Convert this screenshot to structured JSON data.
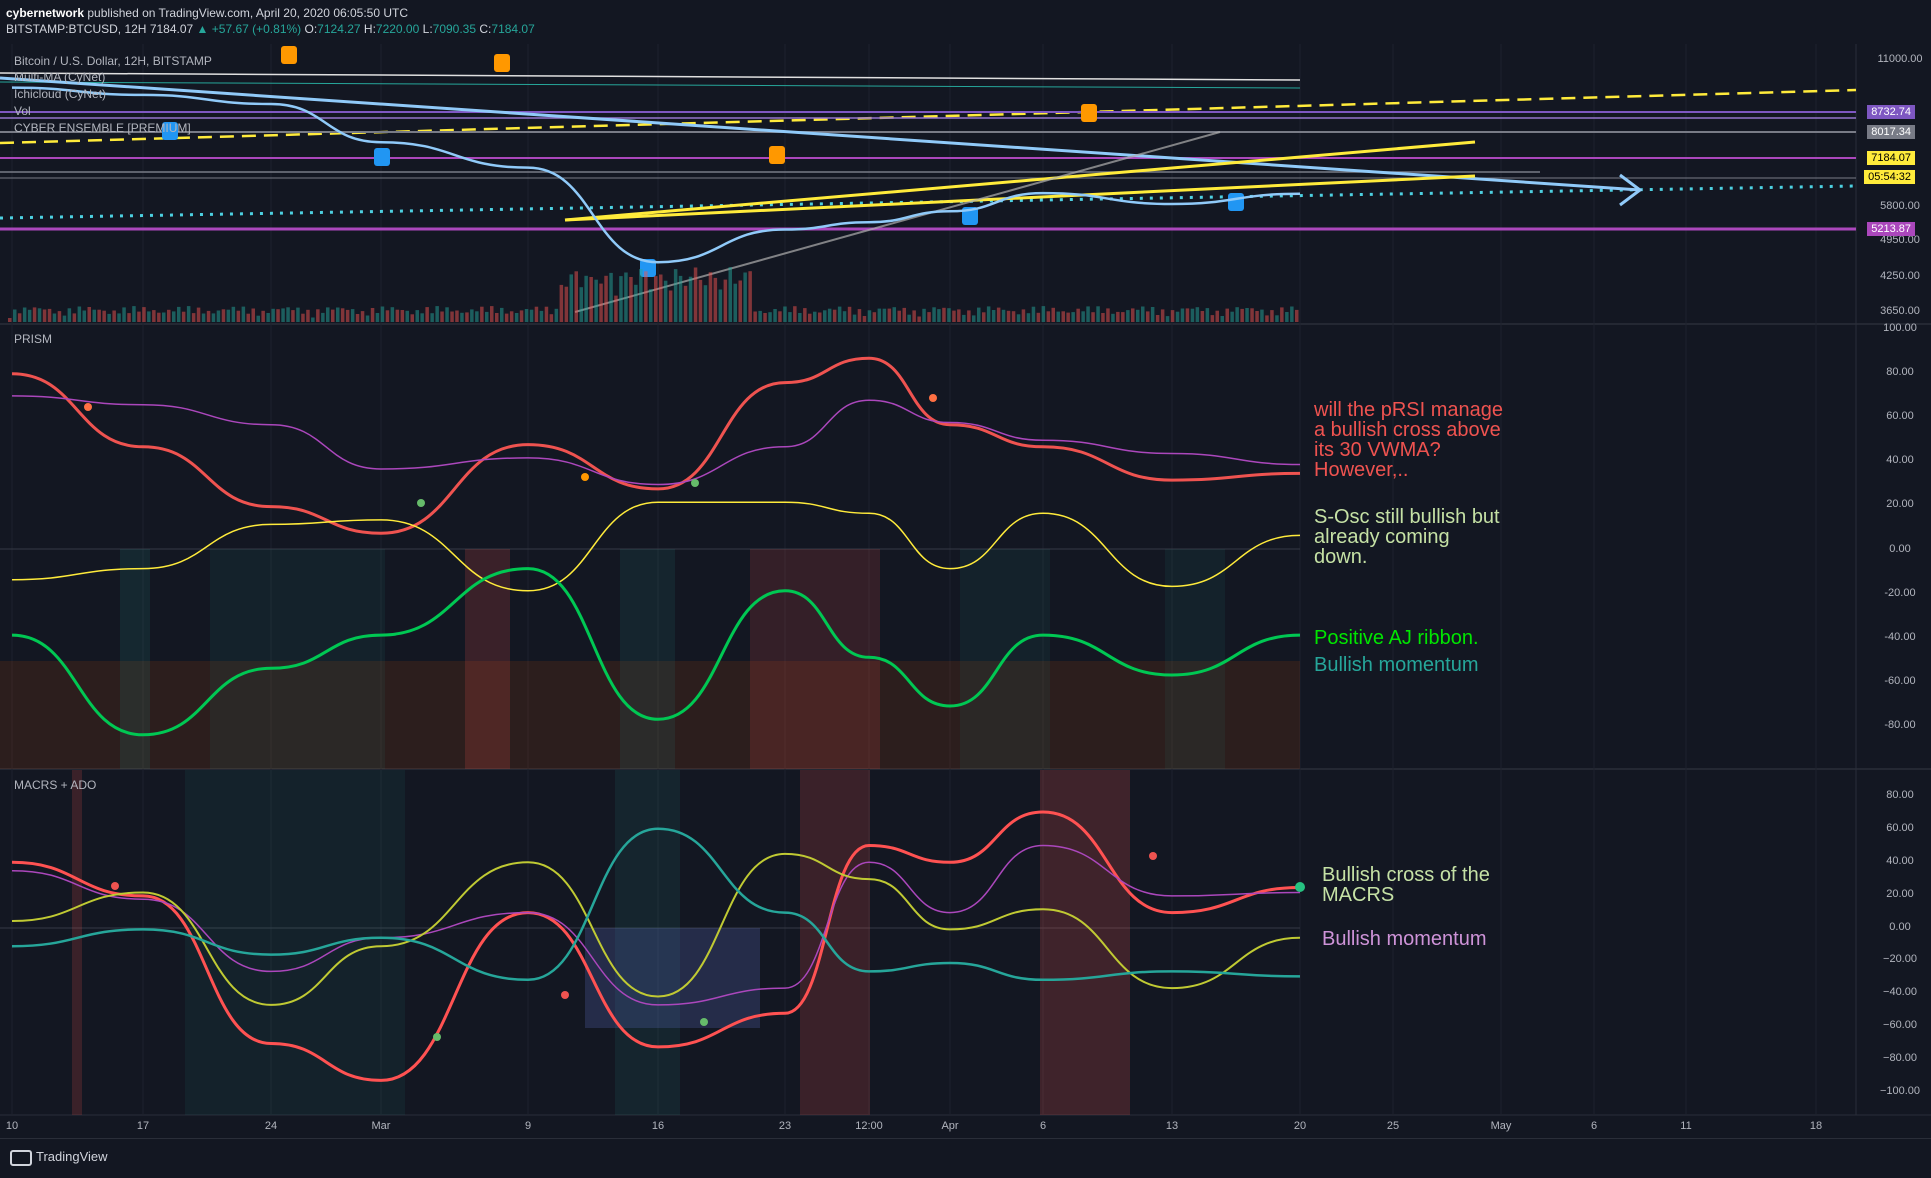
{
  "header": {
    "author": "cybernetwork",
    "published": "published on TradingView.com, April 20, 2020 06:05:50 UTC",
    "symbol": "BITSTAMP:BTCUSD, 12H",
    "last": "7184.07",
    "change": "▲ +57.67 (+0.81%)",
    "o_label": "O:",
    "o": "7124.27",
    "h_label": "H:",
    "h": "7220.00",
    "l_label": "L:",
    "l": "7090.35",
    "c_label": "C:",
    "c": "7184.07"
  },
  "main_pane": {
    "legend": [
      "Bitcoin / U.S. Dollar, 12H, BITSTAMP",
      "Multi-MA (CyNet)",
      "Ichicloud (CyNet)",
      "Vol",
      "CYBER ENSEMBLE [PREMIUM]"
    ],
    "price_ticks": [
      "11000.00",
      "5800.00",
      "4950.00",
      "4250.00",
      "3650.00"
    ],
    "price_boxes": [
      {
        "text": "8732.74",
        "bg": "#7e57c2",
        "fg": "#ffffff"
      },
      {
        "text": "8017.34",
        "bg": "#787b86",
        "fg": "#ffffff"
      },
      {
        "text": "7184.07",
        "bg": "#ffeb3b",
        "fg": "#000000"
      },
      {
        "text": "05:54:32",
        "bg": "#ffeb3b",
        "fg": "#000000"
      },
      {
        "text": "5213.87",
        "bg": "#ab47bc",
        "fg": "#ffffff"
      }
    ]
  },
  "prism_pane": {
    "label": "PRISM",
    "ticks": [
      "100.00",
      "80.00",
      "60.00",
      "40.00",
      "20.00",
      "0.00",
      "-20.00",
      "-40.00",
      "-60.00",
      "-80.00"
    ],
    "annotations": [
      {
        "text": "will the pRSI manage\na bullish cross above\nits 30 VWMA?\nHowever,..",
        "color": "#ef5350"
      },
      {
        "text": "S-Osc still bullish but\nalready coming\ndown.",
        "color": "#c5e1a5"
      },
      {
        "text": "Positive AJ ribbon.",
        "color": "#00e600"
      },
      {
        "text": "Bullish momentum",
        "color": "#26a69a"
      }
    ]
  },
  "macrs_pane": {
    "label": "MACRS + ADO",
    "ticks": [
      "80.00",
      "60.00",
      "40.00",
      "20.00",
      "0.00",
      "−20.00",
      "−40.00",
      "−60.00",
      "−80.00",
      "−100.00"
    ],
    "annotations": [
      {
        "text": "Bullish cross of the\nMACRS",
        "color": "#c5e1a5"
      },
      {
        "text": "Bullish momentum",
        "color": "#ce93d8"
      }
    ]
  },
  "time_axis": [
    "10",
    "17",
    "24",
    "Mar",
    "9",
    "16",
    "23",
    "12:00",
    "Apr",
    "6",
    "13",
    "20",
    "25",
    "May",
    "6",
    "11",
    "18"
  ],
  "footer": {
    "brand": "TradingView"
  },
  "colors": {
    "background": "#131722",
    "bull": "#26a69a",
    "bear": "#ef5350",
    "yellow": "#ffeb3b",
    "purple": "#ab47bc",
    "light_blue": "#90caf9",
    "cyan_dotted": "#4dd0e1"
  },
  "chart_data": [
    {
      "type": "line",
      "title": "Bitcoin / U.S. Dollar, 12H, BITSTAMP",
      "x": [
        "10",
        "17",
        "24",
        "Mar",
        "9",
        "16",
        "23",
        "12:00",
        "Apr",
        "6",
        "13",
        "20"
      ],
      "series": [
        {
          "name": "Bitcoin / U.S. Dollar, 12H, BITSTAMP",
          "values": [
            10100,
            9900,
            9650,
            8600,
            7900,
            5300,
            6200,
            6400,
            6700,
            7200,
            6900,
            7184
          ]
        }
      ],
      "ylim": [
        3600,
        11300
      ],
      "ylabel": ""
    },
    {
      "type": "line",
      "title": "PRISM",
      "x": [
        "10",
        "17",
        "24",
        "Mar",
        "9",
        "16",
        "23",
        "12:00",
        "Apr",
        "6",
        "13",
        "20"
      ],
      "series": [
        {
          "values": [
            78,
            45,
            18,
            6,
            46,
            26,
            74,
            85,
            55,
            45,
            30,
            33
          ]
        },
        {
          "values": [
            68,
            64,
            55,
            35,
            40,
            28,
            45,
            66,
            56,
            48,
            42,
            37
          ]
        },
        {
          "values": [
            -15,
            -10,
            10,
            12,
            -20,
            20,
            20,
            15,
            -10,
            15,
            -18,
            5
          ]
        },
        {
          "values": [
            -40,
            -85,
            -55,
            -40,
            -10,
            -78,
            -20,
            -50,
            -72,
            -40,
            -58,
            -40
          ]
        }
      ],
      "ylim": [
        -100,
        100
      ],
      "ylabel": ""
    },
    {
      "type": "line",
      "title": "MACRS + ADO",
      "x": [
        "10",
        "17",
        "24",
        "Mar",
        "9",
        "16",
        "23",
        "12:00",
        "Apr",
        "6",
        "13",
        "20"
      ],
      "series": [
        {
          "values": [
            40,
            20,
            -68,
            -90,
            10,
            -70,
            -50,
            50,
            40,
            70,
            10,
            25
          ]
        },
        {
          "values": [
            35,
            18,
            -25,
            -5,
            10,
            -45,
            -35,
            40,
            10,
            50,
            20,
            22
          ]
        },
        {
          "values": [
            5,
            22,
            -45,
            -10,
            40,
            -40,
            45,
            30,
            0,
            12,
            -35,
            -5
          ]
        },
        {
          "values": [
            -10,
            0,
            -15,
            -5,
            -30,
            60,
            10,
            -25,
            -20,
            -30,
            -25,
            -28
          ]
        }
      ],
      "ylim": [
        -110,
        95
      ],
      "ylabel": ""
    }
  ]
}
